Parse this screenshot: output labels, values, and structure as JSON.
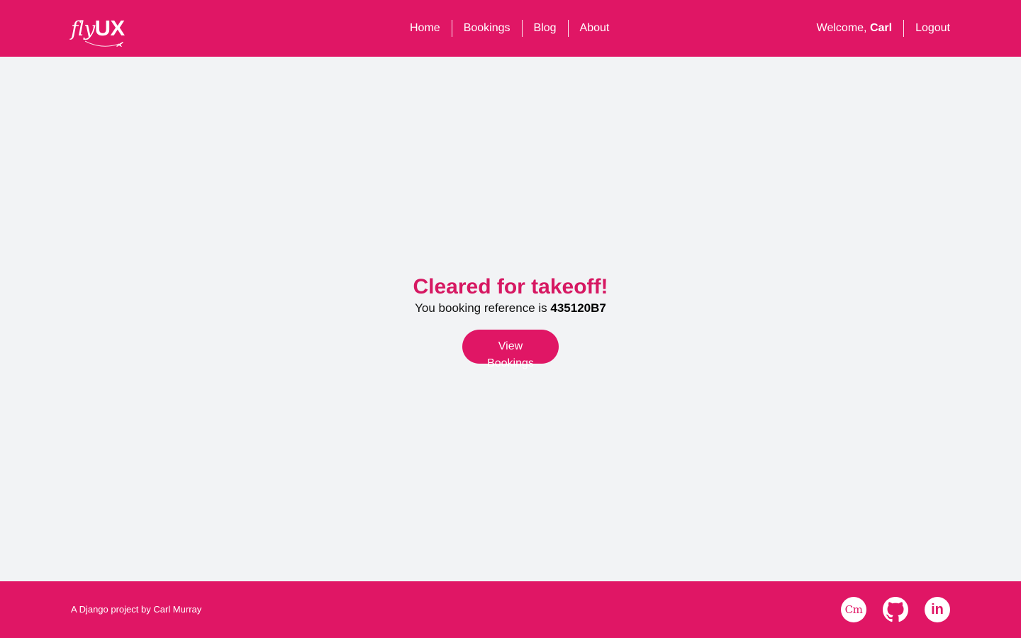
{
  "header": {
    "logo": {
      "fly": "fly",
      "ux": "UX",
      "icon": "plane-icon"
    },
    "nav": [
      "Home",
      "Bookings",
      "Blog",
      "About"
    ],
    "welcome_prefix": "Welcome, ",
    "user_name": "Carl",
    "logout_label": "Logout"
  },
  "main": {
    "title": "Cleared for takeoff!",
    "reference_prefix": "You booking reference is ",
    "reference_code": "435120B7",
    "button_label": "View Bookings"
  },
  "footer": {
    "credit_prefix": "A Django project by ",
    "credit_name": "Carl Murray",
    "socials": {
      "portfolio_label": "Cm",
      "github_icon": "github-icon",
      "linkedin_label": "in"
    }
  },
  "colors": {
    "brand": "#e01665",
    "title": "#d61862",
    "background": "#f2f3f5"
  }
}
